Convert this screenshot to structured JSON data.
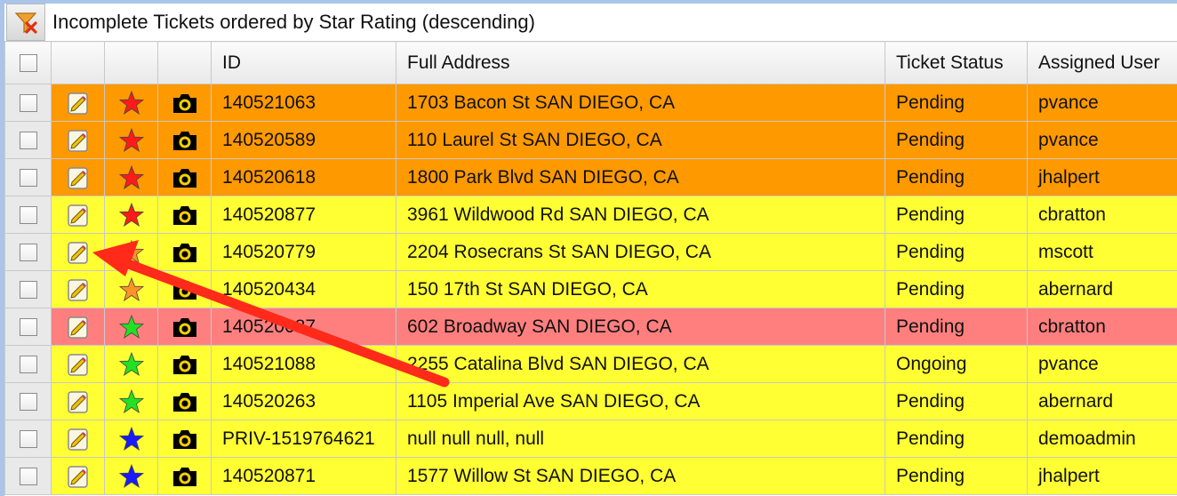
{
  "toolbar": {
    "title": "Incomplete Tickets ordered by Star Rating (descending)",
    "filter_icon": "clear-filter-icon"
  },
  "columns": {
    "id": "ID",
    "address": "Full Address",
    "status": "Ticket Status",
    "user": "Assigned User"
  },
  "colors": {
    "orange_row": "#ff9900",
    "yellow_row": "#ffff33",
    "pink_row": "#ff7f7f",
    "star_red": "#ff1a1a",
    "star_orange": "#ff9326",
    "star_green": "#22e022",
    "star_blue": "#1a1aff",
    "annotation_arrow": "#ff2a1a"
  },
  "rows": [
    {
      "id": "140521063",
      "address": "1703 Bacon St SAN DIEGO, CA",
      "status": "Pending",
      "user": "pvance",
      "row_color": "orange",
      "star": "red"
    },
    {
      "id": "140520589",
      "address": "110 Laurel St SAN DIEGO, CA",
      "status": "Pending",
      "user": "pvance",
      "row_color": "orange",
      "star": "red"
    },
    {
      "id": "140520618",
      "address": "1800 Park Blvd SAN DIEGO, CA",
      "status": "Pending",
      "user": "jhalpert",
      "row_color": "orange",
      "star": "red"
    },
    {
      "id": "140520877",
      "address": "3961 Wildwood Rd SAN DIEGO, CA",
      "status": "Pending",
      "user": "cbratton",
      "row_color": "yellow",
      "star": "red"
    },
    {
      "id": "140520779",
      "address": "2204 Rosecrans St SAN DIEGO, CA",
      "status": "Pending",
      "user": "mscott",
      "row_color": "yellow",
      "star": "orange"
    },
    {
      "id": "140520434",
      "address": "150 17th St SAN DIEGO, CA",
      "status": "Pending",
      "user": "abernard",
      "row_color": "yellow",
      "star": "orange"
    },
    {
      "id": "140520087",
      "address": "602 Broadway SAN DIEGO, CA",
      "status": "Pending",
      "user": "cbratton",
      "row_color": "pink",
      "star": "green"
    },
    {
      "id": "140521088",
      "address": "2255 Catalina Blvd SAN DIEGO, CA",
      "status": "Ongoing",
      "user": "pvance",
      "row_color": "yellow",
      "star": "green"
    },
    {
      "id": "140520263",
      "address": "1105 Imperial Ave SAN DIEGO, CA",
      "status": "Pending",
      "user": "abernard",
      "row_color": "yellow",
      "star": "green"
    },
    {
      "id": "PRIV-1519764621",
      "address": "null null null, null",
      "status": "Pending",
      "user": "demoadmin",
      "row_color": "yellow",
      "star": "blue"
    },
    {
      "id": "140520871",
      "address": "1577 Willow St SAN DIEGO, CA",
      "status": "Pending",
      "user": "jhalpert",
      "row_color": "yellow",
      "star": "blue"
    }
  ]
}
